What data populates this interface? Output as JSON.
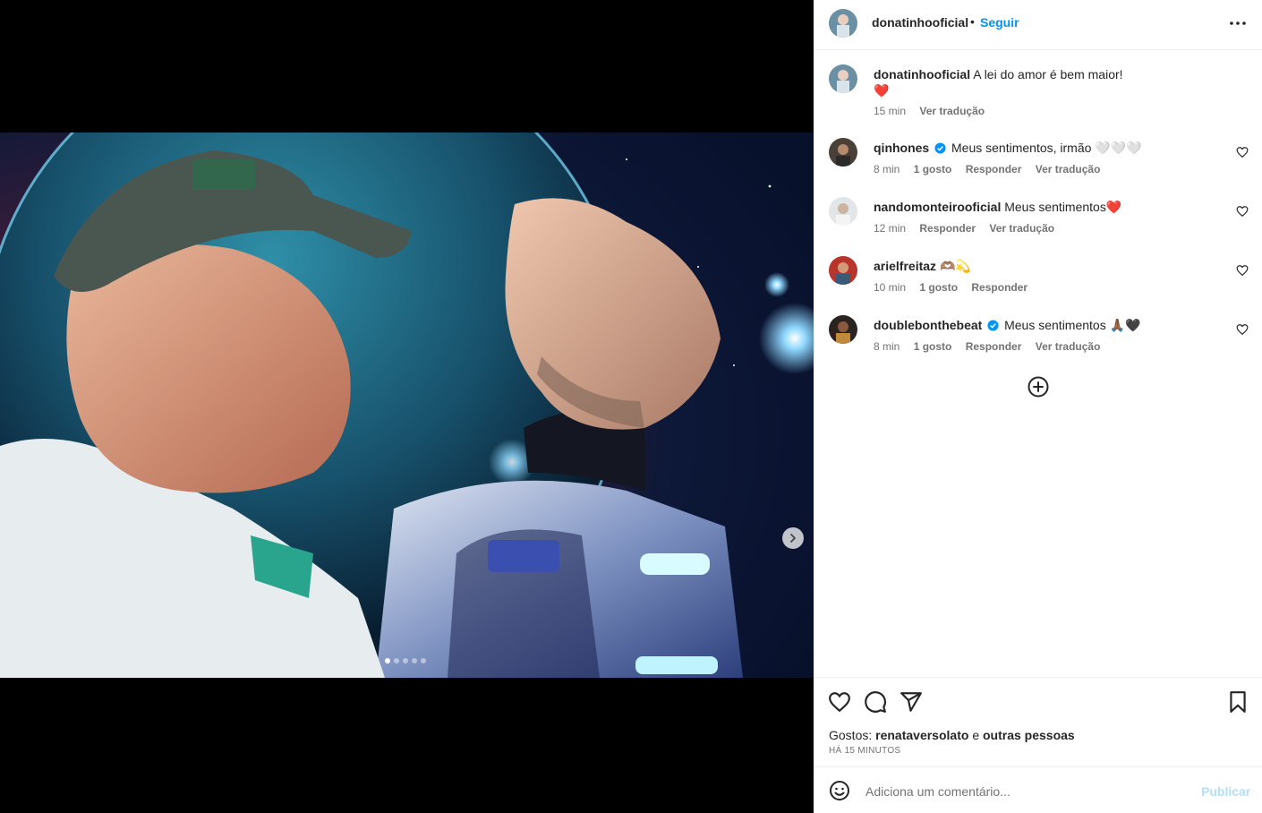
{
  "post": {
    "username": "donatinhooficial",
    "follow_label": "Seguir",
    "caption": "A lei do amor é bem maior!",
    "caption_emoji": "❤️",
    "caption_time": "15 min",
    "caption_translate": "Ver tradução",
    "carousel_count": 5,
    "carousel_active": 0
  },
  "comments": [
    {
      "username": "qinhones",
      "verified": true,
      "text": "Meus sentimentos, irmão 🤍🤍🤍",
      "time": "8 min",
      "likes": "1 gosto",
      "reply": "Responder",
      "translate": "Ver tradução"
    },
    {
      "username": "nandomonteirooficial",
      "verified": false,
      "text": "Meus sentimentos❤️",
      "time": "12 min",
      "likes": "",
      "reply": "Responder",
      "translate": "Ver tradução"
    },
    {
      "username": "arielfreitaz",
      "verified": false,
      "text": "🫶🏽💫",
      "time": "10 min",
      "likes": "1 gosto",
      "reply": "Responder",
      "translate": ""
    },
    {
      "username": "doublebonthebeat",
      "verified": true,
      "text": "Meus sentimentos 🙏🏾🖤",
      "time": "8 min",
      "likes": "1 gosto",
      "reply": "Responder",
      "translate": "Ver tradução"
    }
  ],
  "likes": {
    "prefix": "Gostos:",
    "user": "renataversolato",
    "connector": "e",
    "others": "outras pessoas",
    "posted_ago": "HÁ 15 MINUTOS"
  },
  "compose": {
    "placeholder": "Adiciona um comentário...",
    "publish_label": "Publicar"
  },
  "colors": {
    "link_blue": "#0095f6",
    "publish_disabled": "#b2dffc",
    "verified_blue": "#0095f6",
    "secondary_text": "#737373"
  },
  "icons": [
    "chevron-right-icon",
    "more-icon",
    "heart-icon",
    "comment-icon",
    "share-icon",
    "bookmark-icon",
    "add-circle-icon",
    "emoji-icon",
    "verified-icon"
  ]
}
